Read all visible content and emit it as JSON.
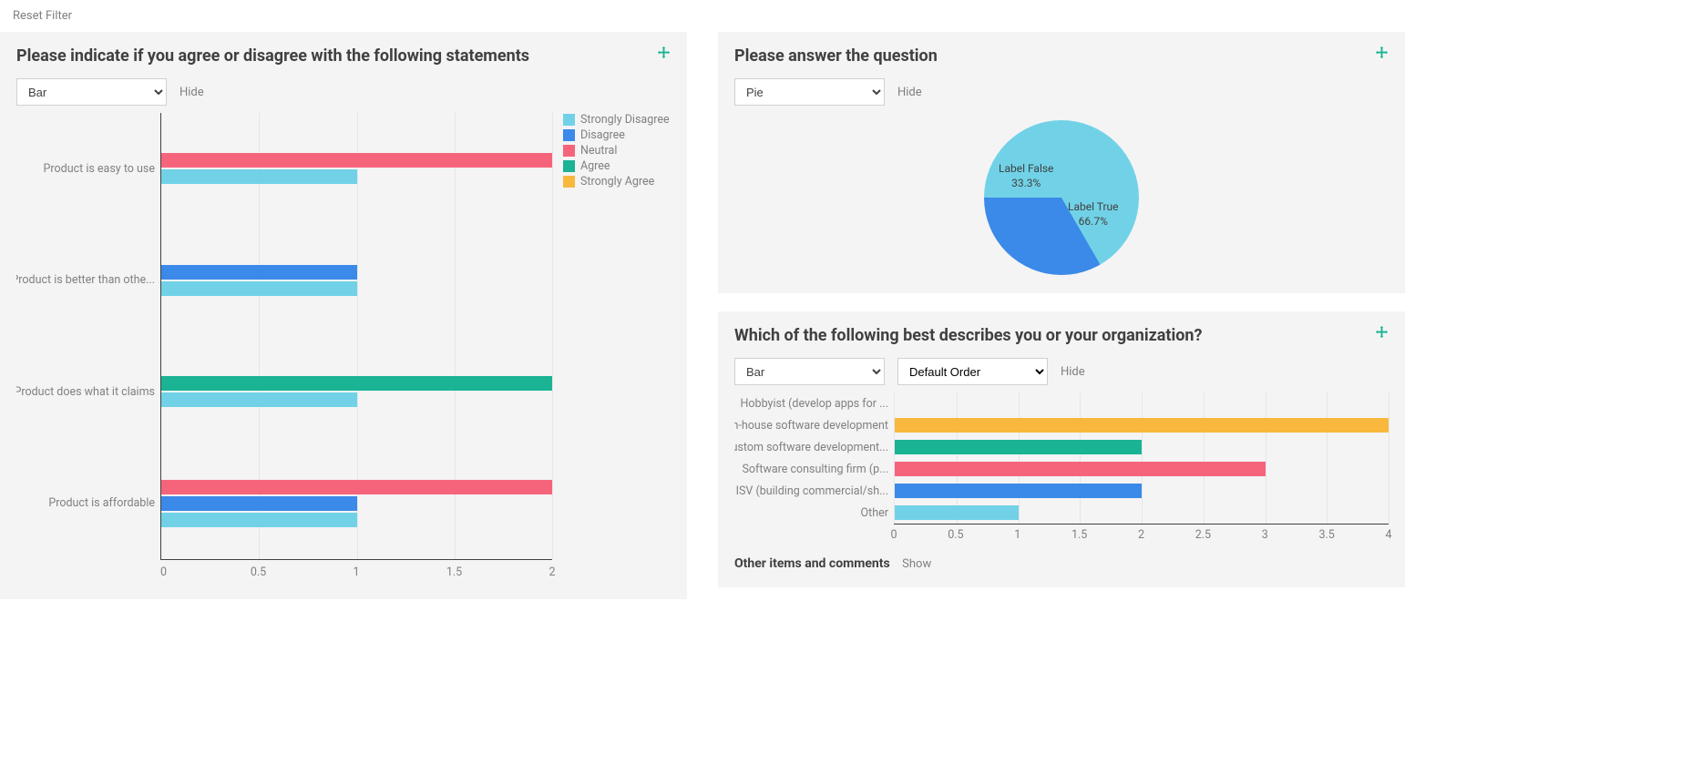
{
  "reset_filter_label": "Reset Filter",
  "hide_label": "Hide",
  "show_label": "Show",
  "palette": {
    "strongly_disagree": "#71d2e7",
    "disagree": "#3b89e8",
    "neutral": "#f6647c",
    "agree": "#1ab394",
    "strongly_agree": "#f8b83d"
  },
  "panel1": {
    "title": "Please indicate if you agree or disagree with the following statements",
    "chart_type_selected": "Bar",
    "legend": [
      "Strongly Disagree",
      "Disagree",
      "Neutral",
      "Agree",
      "Strongly Agree"
    ]
  },
  "panel2": {
    "title": "Please answer the question",
    "chart_type_selected": "Pie"
  },
  "panel3": {
    "title": "Which of the following best describes you or your organization?",
    "chart_type_selected": "Bar",
    "order_selected": "Default Order",
    "other_label": "Other items and comments"
  },
  "chart_data": [
    {
      "id": "panel1",
      "type": "bar",
      "orientation": "horizontal",
      "categories": [
        "Product is easy to use",
        "Product is better than othe...",
        "Product does what it claims",
        "Product is affordable"
      ],
      "series": [
        {
          "name": "Strongly Disagree",
          "color": "#71d2e7",
          "values": [
            1,
            1,
            1,
            1
          ]
        },
        {
          "name": "Disagree",
          "color": "#3b89e8",
          "values": [
            0,
            1,
            0,
            1
          ]
        },
        {
          "name": "Neutral",
          "color": "#f6647c",
          "values": [
            2,
            0,
            0,
            2
          ]
        },
        {
          "name": "Agree",
          "color": "#1ab394",
          "values": [
            0,
            0,
            2,
            0
          ]
        },
        {
          "name": "Strongly Agree",
          "color": "#f8b83d",
          "values": [
            0,
            0,
            0,
            0
          ]
        }
      ],
      "xlim": [
        0,
        2
      ],
      "xticks": [
        0,
        0.5,
        1,
        1.5,
        2
      ]
    },
    {
      "id": "panel2",
      "type": "pie",
      "slices": [
        {
          "label": "Label False",
          "pct_text": "33.3%",
          "value": 33.3333,
          "color": "#3b89e8"
        },
        {
          "label": "Label True",
          "pct_text": "66.7%",
          "value": 66.6667,
          "color": "#71d2e7"
        }
      ]
    },
    {
      "id": "panel3",
      "type": "bar",
      "orientation": "horizontal",
      "categories": [
        "Hobbyist (develop apps for ...",
        "In-house software development",
        "Custom software development...",
        "Software consulting firm (p...",
        "ISV (building commercial/sh...",
        "Other"
      ],
      "colors": [
        "#71d2e7",
        "#f8b83d",
        "#1ab394",
        "#f6647c",
        "#3b89e8",
        "#71d2e7"
      ],
      "values": [
        0,
        4,
        2,
        3,
        2,
        1
      ],
      "xlim": [
        0,
        4
      ],
      "xticks": [
        0,
        0.5,
        1,
        1.5,
        2,
        2.5,
        3,
        3.5,
        4
      ]
    }
  ]
}
